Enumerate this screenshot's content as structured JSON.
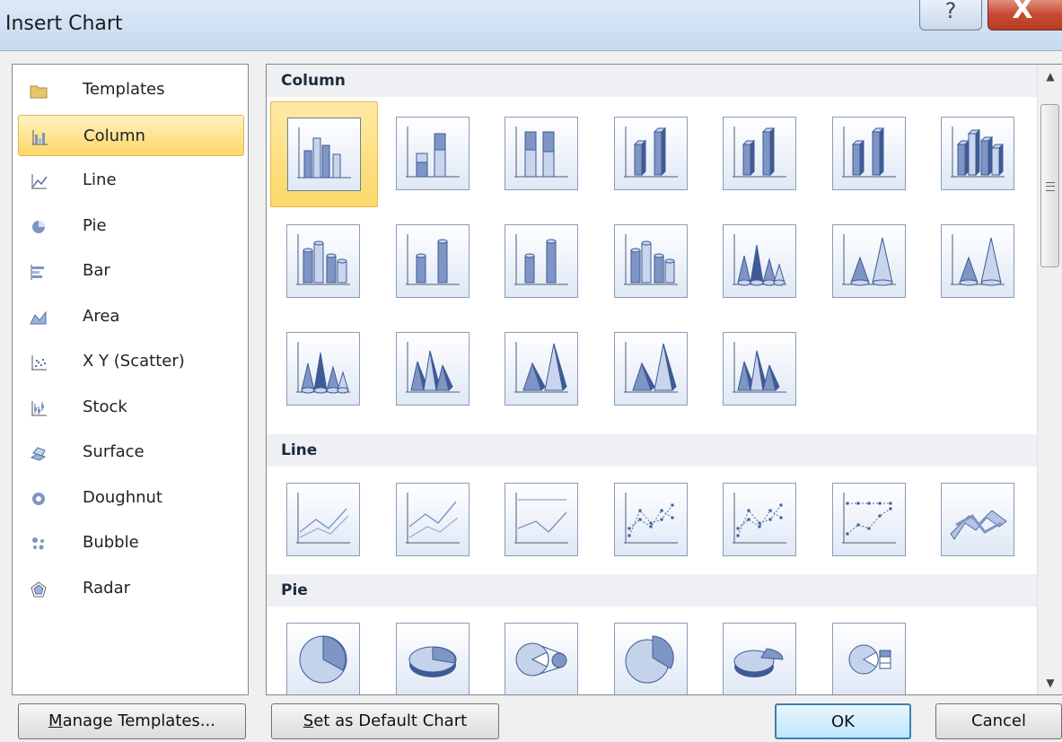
{
  "window": {
    "title": "Insert Chart",
    "help_glyph": "?",
    "close_glyph": "X"
  },
  "categories": [
    {
      "label": "Templates",
      "icon": "folder-icon",
      "selected": false
    },
    {
      "label": "Column",
      "icon": "column-chart-icon",
      "selected": true
    },
    {
      "label": "Line",
      "icon": "line-chart-icon",
      "selected": false
    },
    {
      "label": "Pie",
      "icon": "pie-chart-icon",
      "selected": false
    },
    {
      "label": "Bar",
      "icon": "bar-chart-icon",
      "selected": false
    },
    {
      "label": "Area",
      "icon": "area-chart-icon",
      "selected": false
    },
    {
      "label": "X Y (Scatter)",
      "icon": "scatter-chart-icon",
      "selected": false
    },
    {
      "label": "Stock",
      "icon": "stock-chart-icon",
      "selected": false
    },
    {
      "label": "Surface",
      "icon": "surface-chart-icon",
      "selected": false
    },
    {
      "label": "Doughnut",
      "icon": "doughnut-chart-icon",
      "selected": false
    },
    {
      "label": "Bubble",
      "icon": "bubble-chart-icon",
      "selected": false
    },
    {
      "label": "Radar",
      "icon": "radar-chart-icon",
      "selected": false
    }
  ],
  "gallery": {
    "sections": [
      {
        "title": "Column",
        "rows": [
          [
            "clustered-column-icon",
            "stacked-column-icon",
            "100-stacked-column-icon",
            "3d-clustered-column-icon",
            "3d-stacked-column-icon",
            "3d-100-stacked-column-icon",
            "3d-column-icon"
          ],
          [
            "clustered-cylinder-icon",
            "stacked-cylinder-icon",
            "100-stacked-cylinder-icon",
            "3d-cylinder-icon",
            "clustered-cone-icon",
            "stacked-cone-icon",
            "100-stacked-cone-icon"
          ],
          [
            "3d-cone-icon",
            "clustered-pyramid-icon",
            "stacked-pyramid-icon",
            "100-stacked-pyramid-icon",
            "3d-pyramid-icon"
          ]
        ]
      },
      {
        "title": "Line",
        "rows": [
          [
            "line-icon",
            "stacked-line-icon",
            "100-stacked-line-icon",
            "line-with-markers-icon",
            "stacked-line-with-markers-icon",
            "100-stacked-line-with-markers-icon",
            "3d-line-icon"
          ]
        ]
      },
      {
        "title": "Pie",
        "rows": [
          [
            "pie-icon",
            "3d-pie-icon",
            "pie-of-pie-icon",
            "exploded-pie-icon",
            "exploded-3d-pie-icon",
            "bar-of-pie-icon"
          ]
        ]
      }
    ],
    "selected": "clustered-column-icon"
  },
  "buttons": {
    "manage_templates_mnemonic": "M",
    "manage_templates_rest": "anage Templates...",
    "set_default_mnemonic": "S",
    "set_default_rest": "et as Default Chart",
    "ok": "OK",
    "cancel": "Cancel"
  },
  "colors": {
    "selection": "#fcd867",
    "thumbnail_fill": "#7f95c5",
    "thumbnail_dark": "#3e5b94"
  }
}
